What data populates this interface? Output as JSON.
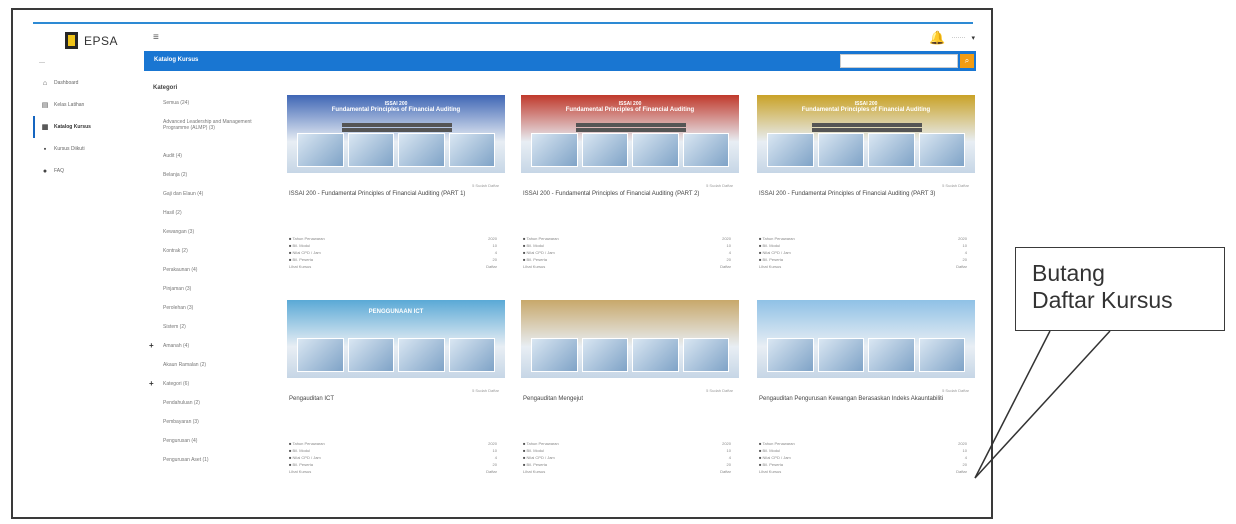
{
  "app": {
    "logo_text": "EPSA",
    "hamburger": "≡"
  },
  "header": {
    "bell_icon": "bell-icon",
    "user_name": "·······",
    "caret": "▾"
  },
  "sidebar": {
    "separator": "—",
    "items": [
      {
        "label": "Dashboard",
        "icon": "home-icon",
        "glyph": "⌂"
      },
      {
        "label": "Kelas Latihan",
        "icon": "book-icon",
        "glyph": "▤"
      },
      {
        "label": "Katalog Kursus",
        "icon": "catalog-icon",
        "glyph": "▦"
      },
      {
        "label": "Kursus Diikuti",
        "icon": "list-icon",
        "glyph": "▪"
      },
      {
        "label": "FAQ",
        "icon": "help-icon",
        "glyph": "●"
      }
    ]
  },
  "banner": {
    "title": "Katalog Kursus",
    "search_placeholder": "",
    "search_icon": "search-icon",
    "search_glyph": "⌕"
  },
  "kategori": {
    "title": "Kategori",
    "items": [
      {
        "label": "Semua (24)",
        "plus": ""
      },
      {
        "label": "Advanced Leadership and Management Programme (ALMP) (3)",
        "plus": ""
      },
      {
        "label": "Audit (4)",
        "plus": ""
      },
      {
        "label": "Belanja (2)",
        "plus": ""
      },
      {
        "label": "Gaji dan Elaun (4)",
        "plus": ""
      },
      {
        "label": "Hasil (2)",
        "plus": ""
      },
      {
        "label": "Kewangan (3)",
        "plus": ""
      },
      {
        "label": "Kontrak (2)",
        "plus": ""
      },
      {
        "label": "Perakaunan (4)",
        "plus": ""
      },
      {
        "label": "Pinjaman (3)",
        "plus": ""
      },
      {
        "label": "Perolehan (3)",
        "plus": ""
      },
      {
        "label": "Sistem (2)",
        "plus": ""
      },
      {
        "label": "Amanah (4)",
        "plus": "+"
      },
      {
        "label": "Akaun Ramalan (2)",
        "plus": ""
      },
      {
        "label": "Kategori (6)",
        "plus": "+"
      },
      {
        "label": "Pendahuluan (2)",
        "plus": ""
      },
      {
        "label": "Pembayaran (3)",
        "plus": ""
      },
      {
        "label": "Pengurusan (4)",
        "plus": ""
      },
      {
        "label": "Pengurusan Aset (1)",
        "plus": ""
      }
    ]
  },
  "courses": [
    {
      "thumb_title_1": "ISSAI 200",
      "thumb_title_2": "Fundamental Principles of Financial Auditing",
      "thumb_color": "#3f66b5",
      "enrolled": "5 Sudah Daftar",
      "title": "ISSAI 200 - Fundamental Principles of Financial Auditing (PART 1)",
      "meta": [
        {
          "k": "Tahun Penawaran",
          "v": "2020"
        },
        {
          "k": "Bil. Modul",
          "v": "10"
        },
        {
          "k": "Nilai CPD / Jam",
          "v": "4"
        },
        {
          "k": "Bil. Peserta",
          "v": "20"
        },
        {
          "k": "Lihat Kursus",
          "v": "Daftar"
        }
      ]
    },
    {
      "thumb_title_1": "ISSAI 200",
      "thumb_title_2": "Fundamental Principles of Financial Auditing",
      "thumb_color": "#c0392b",
      "enrolled": "5 Sudah Daftar",
      "title": "ISSAI 200 - Fundamental Principles of Financial Auditing (PART 2)",
      "meta": [
        {
          "k": "Tahun Penawaran",
          "v": "2020"
        },
        {
          "k": "Bil. Modul",
          "v": "10"
        },
        {
          "k": "Nilai CPD / Jam",
          "v": "4"
        },
        {
          "k": "Bil. Peserta",
          "v": "20"
        },
        {
          "k": "Lihat Kursus",
          "v": "Daftar"
        }
      ]
    },
    {
      "thumb_title_1": "ISSAI 200",
      "thumb_title_2": "Fundamental Principles of Financial Auditing",
      "thumb_color": "#c9a227",
      "enrolled": "5 Sudah Daftar",
      "title": "ISSAI 200 - Fundamental Principles of Financial Auditing (PART 3)",
      "meta": [
        {
          "k": "Tahun Penawaran",
          "v": "2020"
        },
        {
          "k": "Bil. Modul",
          "v": "10"
        },
        {
          "k": "Nilai CPD / Jam",
          "v": "4"
        },
        {
          "k": "Bil. Peserta",
          "v": "20"
        },
        {
          "k": "Lihat Kursus",
          "v": "Daftar"
        }
      ]
    },
    {
      "thumb_title_1": "",
      "thumb_title_2": "PENGGUNAAN ICT",
      "thumb_color": "#5aa9d6",
      "enrolled": "5 Sudah Daftar",
      "title": "Pengauditan ICT",
      "meta": [
        {
          "k": "Tahun Penawaran",
          "v": "2020"
        },
        {
          "k": "Bil. Modul",
          "v": "10"
        },
        {
          "k": "Nilai CPD / Jam",
          "v": "4"
        },
        {
          "k": "Bil. Peserta",
          "v": "20"
        },
        {
          "k": "Lihat Kursus",
          "v": "Daftar"
        }
      ]
    },
    {
      "thumb_title_1": "",
      "thumb_title_2": "",
      "thumb_color": "#c8a86b",
      "enrolled": "5 Sudah Daftar",
      "title": "Pengauditan Mengejut",
      "meta": [
        {
          "k": "Tahun Penawaran",
          "v": "2020"
        },
        {
          "k": "Bil. Modul",
          "v": "10"
        },
        {
          "k": "Nilai CPD / Jam",
          "v": "4"
        },
        {
          "k": "Bil. Peserta",
          "v": "20"
        },
        {
          "k": "Lihat Kursus",
          "v": "Daftar"
        }
      ]
    },
    {
      "thumb_title_1": "",
      "thumb_title_2": "",
      "thumb_color": "#8fc1e6",
      "enrolled": "5 Sudah Daftar",
      "title": "Pengauditan Pengurusan Kewangan Berasaskan Indeks Akauntabiliti",
      "meta": [
        {
          "k": "Tahun Penawaran",
          "v": "2020"
        },
        {
          "k": "Bil. Modul",
          "v": "10"
        },
        {
          "k": "Nilai CPD / Jam",
          "v": "4"
        },
        {
          "k": "Bil. Peserta",
          "v": "20"
        },
        {
          "k": "Lihat Kursus",
          "v": "Daftar"
        }
      ]
    }
  ],
  "callout": {
    "line1": "Butang",
    "line2": "Daftar Kursus"
  }
}
